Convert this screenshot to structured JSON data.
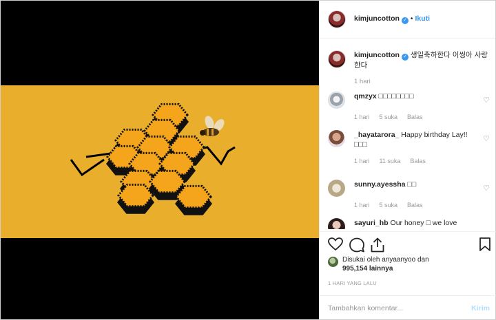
{
  "colors": {
    "accent": "#3897f0",
    "band": "#e9ae2c",
    "honey": "#f4a51c"
  },
  "header": {
    "username": "kimjuncotton",
    "verified_icon": "verified-badge-icon",
    "follow_label": "Ikuti"
  },
  "caption": {
    "username": "kimjuncotton",
    "text": "생일축하한다 이씽아 사랑한다",
    "time": "1 hari"
  },
  "comments": [
    {
      "username": "qmzyx",
      "text": "□□□□□□□□",
      "time": "1 hari",
      "likes": "5 suka",
      "reply": "Balas"
    },
    {
      "username": "_hayatarora_",
      "text": "Happy birthday Lay!! □□□",
      "time": "1 hari",
      "likes": "11 suka",
      "reply": "Balas"
    },
    {
      "username": "sunny.ayessha",
      "text": "□□",
      "time": "1 hari",
      "likes": "5 suka",
      "reply": "Balas"
    },
    {
      "username": "sayuri_hb",
      "text": "Our honey □ we love",
      "time": "",
      "likes": "",
      "reply": ""
    }
  ],
  "likes": {
    "line1": "Disukai oleh anyaanyoo dan",
    "line2": "995,154 lainnya"
  },
  "timestamp": "1 HARI YANG LALU",
  "add_comment": {
    "placeholder": "Tambahkan komentar...",
    "post_label": "Kirim"
  }
}
